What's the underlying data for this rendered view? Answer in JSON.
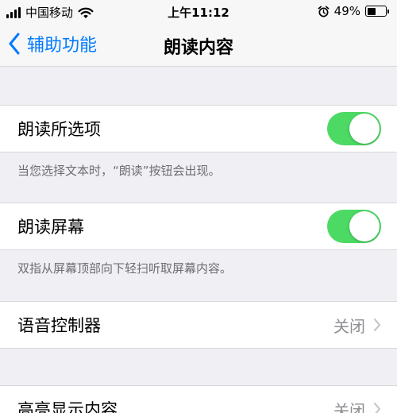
{
  "status_bar": {
    "carrier": "中国移动",
    "time": "上午11:12",
    "battery_percent": "49%",
    "battery_level": 0.49,
    "icons": [
      "signal-icon",
      "wifi-icon",
      "alarm-icon",
      "battery-icon"
    ]
  },
  "nav": {
    "back_label": "辅助功能",
    "title": "朗读内容"
  },
  "settings": {
    "speak_selection": {
      "label": "朗读所选项",
      "enabled": true,
      "footer": "当您选择文本时，“朗读”按钮会出现。"
    },
    "speak_screen": {
      "label": "朗读屏幕",
      "enabled": true,
      "footer": "双指从屏幕顶部向下轻扫听取屏幕内容。"
    },
    "speech_controller": {
      "label": "语音控制器",
      "value": "关闭"
    },
    "highlight_content": {
      "label": "高亮显示内容",
      "value": "关闭"
    }
  },
  "colors": {
    "accent": "#007aff",
    "toggle_on": "#4cd964",
    "background": "#efeff4",
    "secondary_text": "#6d6d72"
  }
}
